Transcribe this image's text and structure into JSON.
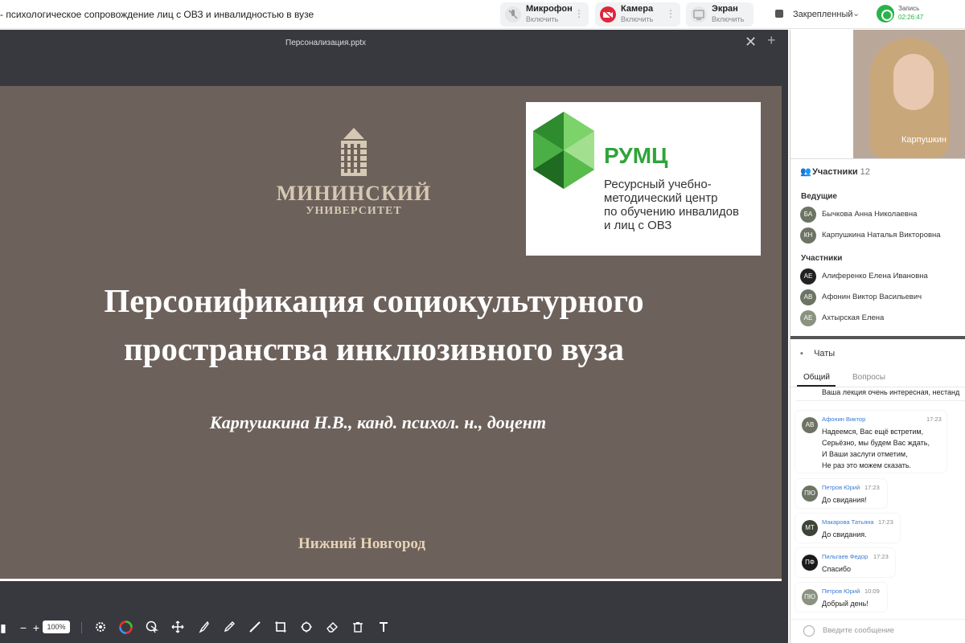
{
  "header": {
    "title": "- психологическое сопровождение лиц с ОВЗ и инвалидностью в вузе",
    "mic": {
      "label": "Микрофон",
      "state": "Включить"
    },
    "camera": {
      "label": "Камера",
      "state": "Включить"
    },
    "screen": {
      "label": "Экран",
      "state": "Включить"
    },
    "pinned": "Закрепленный",
    "recording_label": "Запись",
    "recording_time": "02:26:47"
  },
  "presentation": {
    "file_name": "Персонализация.pptx",
    "close": "✕",
    "add": "+"
  },
  "slide": {
    "logo_name_line1": "МИНИНСКИЙ",
    "logo_name_line2": "УНИВЕРСИТЕТ",
    "rumc_name": "РУМЦ",
    "rumc_desc_1": "Ресурсный учебно-",
    "rumc_desc_2": "методический центр",
    "rumc_desc_3": "по обучению инвалидов",
    "rumc_desc_4": "и лиц с ОВЗ",
    "title_line1": "Персонификация социокультурного",
    "title_line2": "пространства инклюзивного вуза",
    "author": "Карпушкина Н.В., канд. психол. н., доцент",
    "city": "Нижний Новгород"
  },
  "toolbar": {
    "zoom_minus": "−",
    "zoom_plus": "+",
    "zoom_value": "100%"
  },
  "video": {
    "speaker_name": "Карпушкин"
  },
  "participants": {
    "label": "Участники",
    "count": "12",
    "hosts_label": "Ведущие",
    "hosts": [
      {
        "initials": "БА",
        "name": "Бычкова Анна Николаевна"
      },
      {
        "initials": "КН",
        "name": "Карпушкина Наталья Викторовна"
      }
    ],
    "members_label": "Участники",
    "members": [
      {
        "initials": "АЕ",
        "name": "Алиференко Елена Ивановна"
      },
      {
        "initials": "АВ",
        "name": "Афонин Виктор Васильевич"
      },
      {
        "initials": "АЕ",
        "name": "Ахтырская Елена"
      }
    ]
  },
  "chat": {
    "label": "Чаты",
    "tab_general": "Общий",
    "tab_questions": "Вопросы",
    "partial_message": "Ваша лекция очень интересная, нестанд",
    "messages": [
      {
        "initials": "АВ",
        "author": "Афонин Виктор",
        "time": "17:23",
        "line1": "Надеемся, Вас ещё встретим,",
        "line2": "Серьёзно, мы будем Вас ждать,",
        "line3": "И Ваши заслуги отметим,",
        "line4": "Не раз это можем сказать."
      },
      {
        "initials": "ПЮ",
        "author": "Петров Юрий",
        "time": "17:23",
        "text": "До свидания!"
      },
      {
        "initials": "МТ",
        "author": "Макарова Татьяна",
        "time": "17:23",
        "text": "До свидания."
      },
      {
        "initials": "ПФ",
        "author": "Пильгаев Федор",
        "time": "17:23",
        "text": "Спасибо"
      },
      {
        "initials": "ПЮ",
        "author": "Петров Юрий",
        "time": "10:09",
        "text": "Добрый день!"
      }
    ],
    "input_placeholder": "Введите сообщение"
  },
  "colors": {
    "accent_green": "#27b34b",
    "camera_red": "#e0263a",
    "slide_bg": "#6d615b"
  }
}
